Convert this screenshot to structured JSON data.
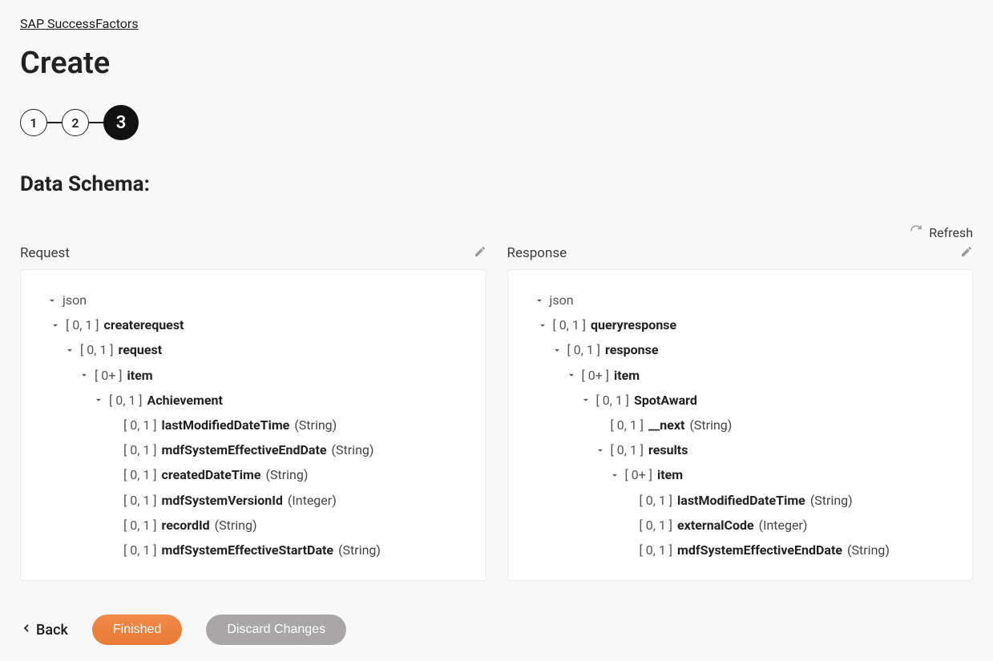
{
  "breadcrumb": "SAP SuccessFactors",
  "title": "Create",
  "steps": {
    "s1": "1",
    "s2": "2",
    "s3": "3",
    "active": 3
  },
  "section_title": "Data Schema:",
  "refresh_label": "Refresh",
  "request": {
    "label": "Request",
    "root": "json",
    "n1": {
      "card": "[ 0, 1 ]",
      "name": "createrequest"
    },
    "n2": {
      "card": "[ 0, 1 ]",
      "name": "request"
    },
    "n3": {
      "card": "[ 0+ ]",
      "name": "item"
    },
    "n4": {
      "card": "[ 0, 1 ]",
      "name": "Achievement"
    },
    "f1": {
      "card": "[ 0, 1 ]",
      "name": "lastModifiedDateTime",
      "type": "(String)"
    },
    "f2": {
      "card": "[ 0, 1 ]",
      "name": "mdfSystemEffectiveEndDate",
      "type": "(String)"
    },
    "f3": {
      "card": "[ 0, 1 ]",
      "name": "createdDateTime",
      "type": "(String)"
    },
    "f4": {
      "card": "[ 0, 1 ]",
      "name": "mdfSystemVersionId",
      "type": "(Integer)"
    },
    "f5": {
      "card": "[ 0, 1 ]",
      "name": "recordId",
      "type": "(String)"
    },
    "f6": {
      "card": "[ 0, 1 ]",
      "name": "mdfSystemEffectiveStartDate",
      "type": "(String)"
    }
  },
  "response": {
    "label": "Response",
    "root": "json",
    "n1": {
      "card": "[ 0, 1 ]",
      "name": "queryresponse"
    },
    "n2": {
      "card": "[ 0, 1 ]",
      "name": "response"
    },
    "n3": {
      "card": "[ 0+ ]",
      "name": "item"
    },
    "n4": {
      "card": "[ 0, 1 ]",
      "name": "SpotAward"
    },
    "f1": {
      "card": "[ 0, 1 ]",
      "name": "__next",
      "type": "(String)"
    },
    "n5": {
      "card": "[ 0, 1 ]",
      "name": "results"
    },
    "n6": {
      "card": "[ 0+ ]",
      "name": "item"
    },
    "g1": {
      "card": "[ 0, 1 ]",
      "name": "lastModifiedDateTime",
      "type": "(String)"
    },
    "g2": {
      "card": "[ 0, 1 ]",
      "name": "externalCode",
      "type": "(Integer)"
    },
    "g3": {
      "card": "[ 0, 1 ]",
      "name": "mdfSystemEffectiveEndDate",
      "type": "(String)"
    }
  },
  "footer": {
    "back": "Back",
    "finished": "Finished",
    "discard": "Discard Changes"
  }
}
